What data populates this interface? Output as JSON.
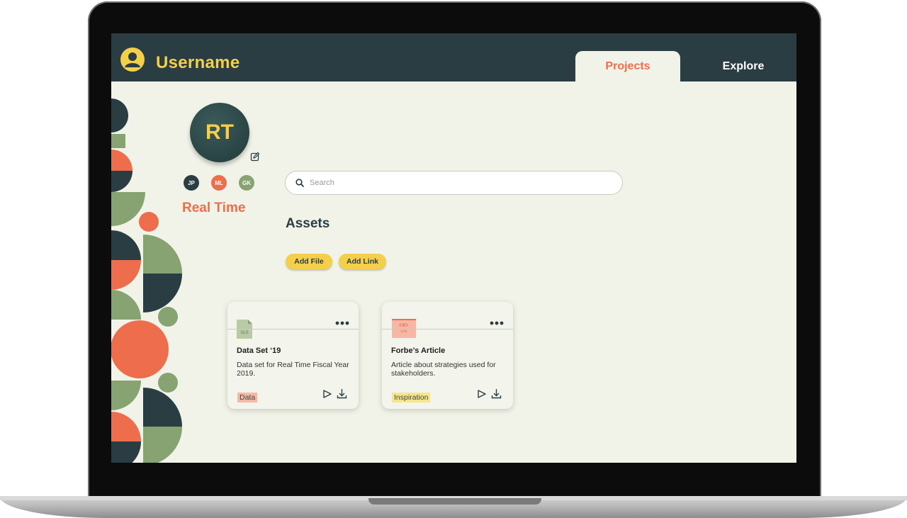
{
  "header": {
    "username": "Username",
    "tabs": [
      {
        "label": "Projects",
        "active": true
      },
      {
        "label": "Explore",
        "active": false
      }
    ]
  },
  "profile": {
    "initials": "RT",
    "project_name": "Real Time",
    "members": [
      "JP",
      "ML",
      "GK"
    ]
  },
  "search": {
    "placeholder": "Search",
    "icon": "search-icon"
  },
  "assets": {
    "title": "Assets",
    "add_file_label": "Add File",
    "add_link_label": "Add Link"
  },
  "cards": [
    {
      "title": "Data Set ‘19",
      "description": "Data set for Real Time Fiscal Year 2019.",
      "tag": "Data",
      "thumb": "XLS",
      "icon": "xls-file-icon"
    },
    {
      "title": "Forbe’s Article",
      "description": "Article about strategies used for stakeholders.",
      "tag": "Inspiration",
      "thumb": "Link",
      "icon": "link-thumbnail-icon"
    }
  ],
  "colors": {
    "header_bg": "#2a3d43",
    "screen_bg": "#f1f3e8",
    "accent_yellow": "#f4cf4a",
    "accent_orange": "#ee6d4c",
    "accent_green": "#87a372"
  }
}
